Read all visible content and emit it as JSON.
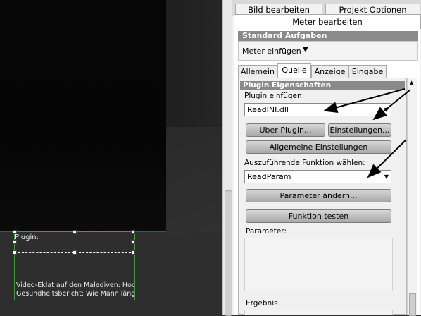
{
  "canvas": {
    "plugin_label": "Plugin:",
    "news_line1": "Video-Eklat auf den Malediven: Hoc",
    "news_line2": "Gesundheitsbericht: Wie Mann läng"
  },
  "panel": {
    "top_tabs": [
      "Bild bearbeiten",
      "Projekt Optionen"
    ],
    "active_top_tab": "Meter bearbeiten",
    "standard_tasks": {
      "header": "Standard Aufgaben",
      "insert_meter": "Meter einfügen",
      "insert_meter_arrow": "▼"
    },
    "sub_tabs": [
      "Allemein",
      "Quelle",
      "Anzeige",
      "Eingabe"
    ],
    "active_sub_tab": "Quelle",
    "plugin_props": {
      "header": "Plugin Eigenschaften",
      "insert_plugin_label": "Plugin einfügen:",
      "plugin_value": "ReadINI.dll",
      "about_button": "Über Plugin...",
      "settings_button": "Einstellungen...",
      "general_settings_button": "Allgemeine Einstellungen",
      "function_label": "Auszuführende Funktion wählen:",
      "function_value": "ReadParam",
      "change_params_button": "Parameter ändern...",
      "test_function_button": "Funktion testen",
      "parameter_label": "Parameter:",
      "result_label": "Ergebnis:"
    }
  },
  "colors": {
    "canvas_bg": "#2e2e2e",
    "selection_green": "#3e9c3e",
    "header_gray": "#8a8a8a"
  }
}
